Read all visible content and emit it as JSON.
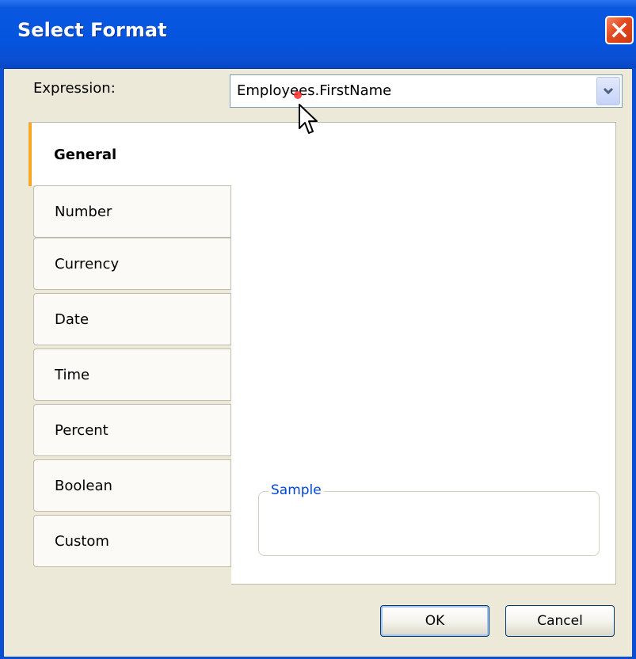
{
  "window": {
    "title": "Select Format",
    "titlebar_color": "#0454df"
  },
  "expression": {
    "label": "Expression:",
    "value": "Employees.FirstName"
  },
  "tabs": [
    {
      "label": "General",
      "selected": true
    },
    {
      "label": "Number",
      "selected": false
    },
    {
      "label": "Currency",
      "selected": false
    },
    {
      "label": "Date",
      "selected": false
    },
    {
      "label": "Time",
      "selected": false
    },
    {
      "label": "Percent",
      "selected": false
    },
    {
      "label": "Boolean",
      "selected": false
    },
    {
      "label": "Custom",
      "selected": false
    }
  ],
  "sample": {
    "label": "Sample",
    "label_color": "#0046d5"
  },
  "buttons": {
    "ok": "OK",
    "cancel": "Cancel"
  },
  "colors": {
    "selected_tab_accent": "#f7a721",
    "close_button": "#e4481f"
  }
}
